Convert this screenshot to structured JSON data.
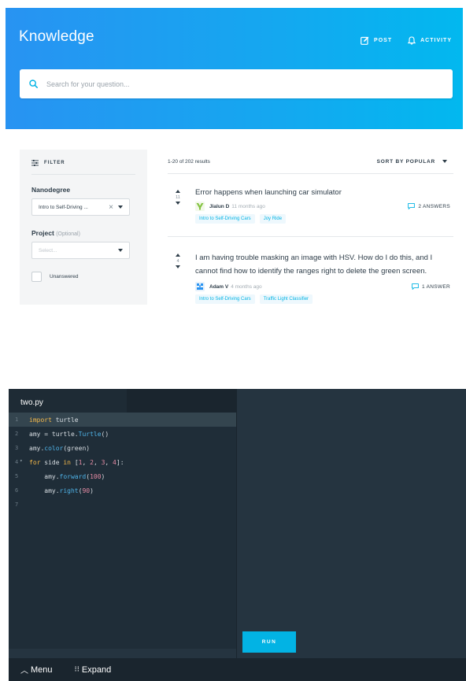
{
  "header": {
    "title": "Knowledge",
    "post_label": "POST",
    "activity_label": "ACTIVITY",
    "search_placeholder": "Search for your question..."
  },
  "filter": {
    "title": "FILTER",
    "nanodegree_label": "Nanodegree",
    "nanodegree_value": "Intro to Self-Driving ...",
    "project_label": "Project",
    "project_optional": "(Optional)",
    "project_placeholder": "Select...",
    "unanswered_label": "Unanswered"
  },
  "results": {
    "count_text": "1-20 of 202 results",
    "sort_label": "SORT BY POPULAR",
    "questions": [
      {
        "title": "Error happens when launching car simulator",
        "votes": "11",
        "author": "Jialun D",
        "time": "11 months ago",
        "answers": "2 ANSWERS",
        "tags": [
          "Intro to Self-Driving Cars",
          "Joy Ride"
        ]
      },
      {
        "title": "I am having trouble masking an image with HSV. How do I do this, and I cannot find how to identify the ranges right to delete the green screen.",
        "votes": "4",
        "author": "Adam V",
        "time": "4 months ago",
        "answers": "1 ANSWER",
        "tags": [
          "Intro to Self-Driving Cars",
          "Traffic Light Classifier"
        ]
      }
    ]
  },
  "editor": {
    "tab_label": "two.py",
    "line_numbers": [
      "1",
      "2",
      "3",
      "4",
      "5",
      "6",
      "7"
    ],
    "code": {
      "l1_kw": "import",
      "l1_rest": " turtle",
      "l2_a": "amy = turtle.",
      "l2_fn": "Turtle",
      "l2_b": "()",
      "l3_a": "amy.",
      "l3_fn": "color",
      "l3_b": "(green)",
      "l4_kw1": "for",
      "l4_a": " side ",
      "l4_kw2": "in",
      "l4_b": " [",
      "l4_n1": "1",
      "l4_c1": ", ",
      "l4_n2": "2",
      "l4_c2": ", ",
      "l4_n3": "3",
      "l4_c3": ", ",
      "l4_n4": "4",
      "l4_d": "]:",
      "l5_a": "    amy.",
      "l5_fn": "forward",
      "l5_b": "(",
      "l5_n": "100",
      "l5_c": ")",
      "l6_a": "    amy.",
      "l6_fn": "right",
      "l6_b": "(",
      "l6_n": "90",
      "l6_c": ")"
    },
    "run_label": "RUN",
    "menu_label": "Menu",
    "expand_label": "Expand"
  },
  "icons": {
    "search": "search-icon",
    "post": "edit-icon",
    "activity": "bell-icon",
    "filter": "sliders-icon",
    "answers": "comment-icon"
  },
  "colors": {
    "header_start": "#2893f2",
    "header_end": "#02b8ef",
    "accent": "#02b3e4",
    "editor_bg": "#253440",
    "keyword": "#f5b94a",
    "function": "#4fb3e8",
    "number": "#e48aa3"
  }
}
